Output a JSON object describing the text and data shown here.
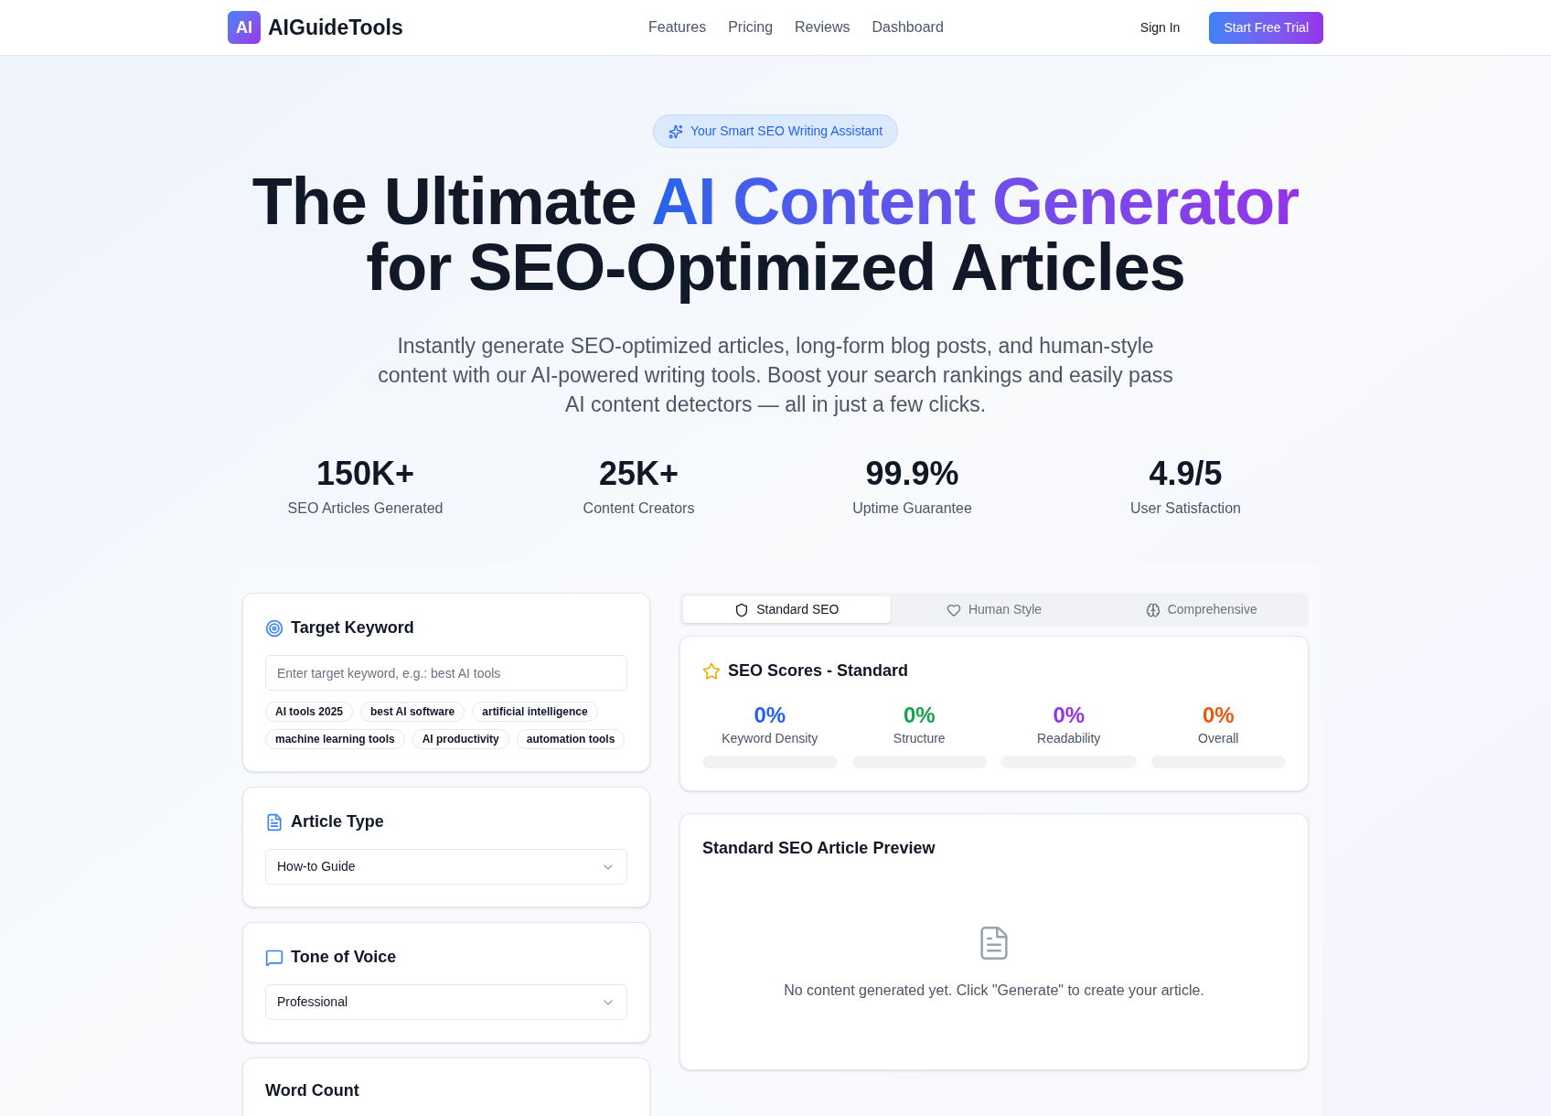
{
  "header": {
    "logo_mark": "AI",
    "brand": "AIGuideTools",
    "nav": [
      "Features",
      "Pricing",
      "Reviews",
      "Dashboard"
    ],
    "sign_in": "Sign In",
    "cta": "Start Free Trial"
  },
  "hero": {
    "badge": "Your Smart SEO Writing Assistant",
    "headline": {
      "before": "The Ultimate ",
      "highlight": "AI Content Generator",
      "after": "for SEO-Optimized Articles"
    },
    "subtitle": "Instantly generate SEO-optimized articles, long-form blog posts, and human-style content with our AI-powered writing tools. Boost your search rankings and easily pass AI content detectors — all in just a few clicks."
  },
  "stats": [
    {
      "value": "150K+",
      "label": "SEO Articles Generated"
    },
    {
      "value": "25K+",
      "label": "Content Creators"
    },
    {
      "value": "99.9%",
      "label": "Uptime Guarantee"
    },
    {
      "value": "4.9/5",
      "label": "User Satisfaction"
    }
  ],
  "target_keyword": {
    "title": "Target Keyword",
    "placeholder": "Enter target keyword, e.g.: best AI tools",
    "suggestions": [
      "AI tools 2025",
      "best AI software",
      "artificial intelligence",
      "machine learning tools",
      "AI productivity",
      "automation tools"
    ]
  },
  "article_type": {
    "title": "Article Type",
    "value": "How-to Guide"
  },
  "tone": {
    "title": "Tone of Voice",
    "value": "Professional"
  },
  "word_count": {
    "title": "Word Count"
  },
  "tabs": [
    {
      "label": "Standard SEO",
      "kind": "shield",
      "selected": true
    },
    {
      "label": "Human Style",
      "kind": "heart",
      "selected": false
    },
    {
      "label": "Comprehensive",
      "kind": "brain",
      "selected": false
    }
  ],
  "scores": {
    "title": "SEO Scores - Standard",
    "items": [
      {
        "value": "0%",
        "label": "Keyword Density",
        "color": "#2563eb",
        "level": 0
      },
      {
        "value": "0%",
        "label": "Structure",
        "color": "#16a34a",
        "level": 0
      },
      {
        "value": "0%",
        "label": "Readability",
        "color": "#9333ea",
        "level": 0
      },
      {
        "value": "0%",
        "label": "Overall",
        "color": "#ea580c",
        "level": 0
      }
    ]
  },
  "preview": {
    "title": "Standard SEO Article Preview",
    "empty_message": "No content generated yet. Click \"Generate\" to create your article."
  }
}
